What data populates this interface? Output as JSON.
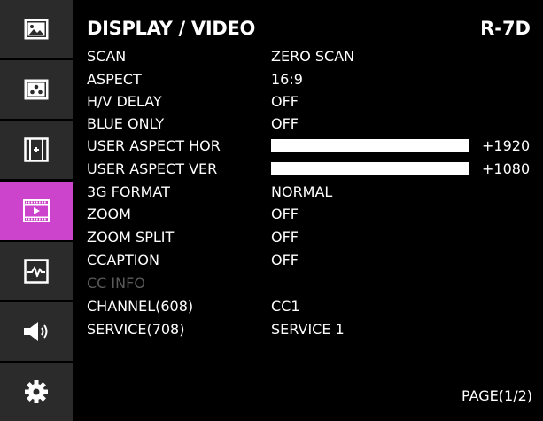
{
  "header": {
    "title": "DISPLAY / VIDEO",
    "model": "R-7D"
  },
  "sidebar": {
    "items": [
      {
        "icon": "image-icon",
        "active": false
      },
      {
        "icon": "color-dots-icon",
        "active": false
      },
      {
        "icon": "marker-frame-icon",
        "active": false
      },
      {
        "icon": "video-film-icon",
        "active": true
      },
      {
        "icon": "waveform-icon",
        "active": false
      },
      {
        "icon": "speaker-icon",
        "active": false
      },
      {
        "icon": "gear-icon",
        "active": false
      }
    ],
    "active_color": "#cc44cc",
    "item_color": "#2b2b2b"
  },
  "menu": {
    "rows": [
      {
        "label": "SCAN",
        "value": "ZERO SCAN"
      },
      {
        "label": "ASPECT",
        "value": "16:9"
      },
      {
        "label": "H/V DELAY",
        "value": "OFF"
      },
      {
        "label": "BLUE ONLY",
        "value": "OFF"
      },
      {
        "label": "USER ASPECT HOR",
        "value": "+1920",
        "level": 1.0
      },
      {
        "label": "USER ASPECT VER",
        "value": "+1080",
        "level": 1.0
      },
      {
        "label": "3G FORMAT",
        "value": "NORMAL"
      },
      {
        "label": "ZOOM",
        "value": "OFF"
      },
      {
        "label": "ZOOM SPLIT",
        "value": "OFF"
      },
      {
        "label": "CCAPTION",
        "value": "OFF"
      },
      {
        "label": "CC INFO",
        "value": "",
        "disabled": true
      },
      {
        "label": "CHANNEL(608)",
        "value": "CC1"
      },
      {
        "label": "SERVICE(708)",
        "value": "SERVICE 1"
      }
    ]
  },
  "footer": {
    "page": "PAGE(1/2)"
  }
}
